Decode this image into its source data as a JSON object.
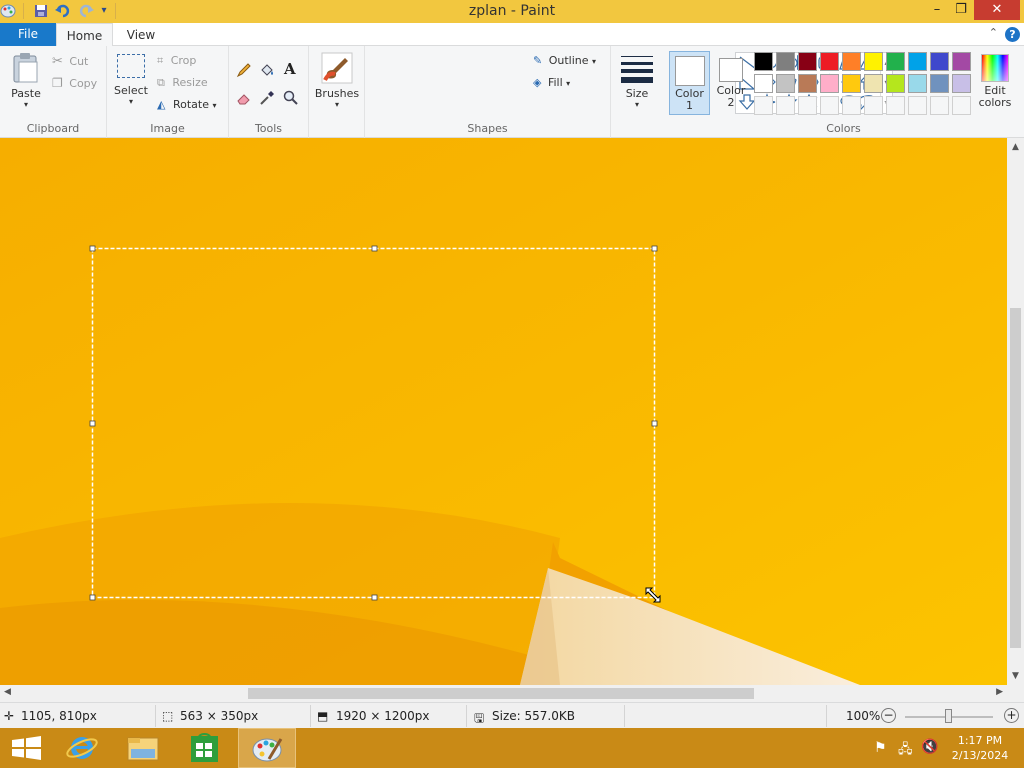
{
  "window": {
    "title": "zplan - Paint",
    "minimize_glyph": "–",
    "restore_glyph": "❐",
    "close_glyph": "✕"
  },
  "quick_access": {
    "icons": [
      "paint-app-icon",
      "save-icon",
      "undo-icon",
      "redo-icon",
      "customize-icon"
    ]
  },
  "tabs": {
    "file": "File",
    "home": "Home",
    "view": "View",
    "help": "?"
  },
  "ribbon": {
    "clipboard": {
      "label": "Clipboard",
      "paste": "Paste",
      "cut": "Cut",
      "copy": "Copy"
    },
    "image": {
      "label": "Image",
      "select": "Select",
      "crop": "Crop",
      "resize": "Resize",
      "rotate": "Rotate"
    },
    "tools": {
      "label": "Tools",
      "text_glyph": "A"
    },
    "brushes": {
      "label": "Brushes"
    },
    "shapes": {
      "label": "Shapes",
      "outline": "Outline",
      "fill": "Fill"
    },
    "size": {
      "label": "Size"
    },
    "colors": {
      "label": "Colors",
      "color1": "Color",
      "color1_num": "1",
      "color2": "Color",
      "color2_num": "2",
      "edit": "Edit",
      "edit2": "colors",
      "palette_row1": [
        "#000000",
        "#7f7f7f",
        "#880015",
        "#ed1c24",
        "#ff7f27",
        "#fff200",
        "#22b14c",
        "#00a2e8",
        "#3f48cc",
        "#a349a4"
      ],
      "palette_row2": [
        "#ffffff",
        "#c3c3c3",
        "#b97a57",
        "#ffaec9",
        "#ffc90e",
        "#efe4b0",
        "#b5e61d",
        "#99d9ea",
        "#7092be",
        "#c8bfe7"
      ],
      "palette_row3": [
        "#f5f6f7",
        "#f5f6f7",
        "#f5f6f7",
        "#f5f6f7",
        "#f5f6f7",
        "#f5f6f7",
        "#f5f6f7",
        "#f5f6f7",
        "#f5f6f7",
        "#f5f6f7"
      ]
    }
  },
  "statusbar": {
    "cursor_pos": "1105, 810px",
    "selection_size": "563 × 350px",
    "image_size": "1920 × 1200px",
    "file_size": "Size: 557.0KB",
    "zoom": "100%",
    "zoom_level_fraction": 0.5
  },
  "taskbar": {
    "time": "1:17 PM",
    "date": "2/13/2024",
    "apps": [
      "windows-start-icon",
      "internet-explorer-icon",
      "file-explorer-icon",
      "store-icon",
      "paint-icon"
    ]
  },
  "colors": {
    "titlebar": "#f2c73f",
    "accent_blue": "#1979ca",
    "canvas_yellow": "#f7b800",
    "taskbar": "#c98a16"
  }
}
